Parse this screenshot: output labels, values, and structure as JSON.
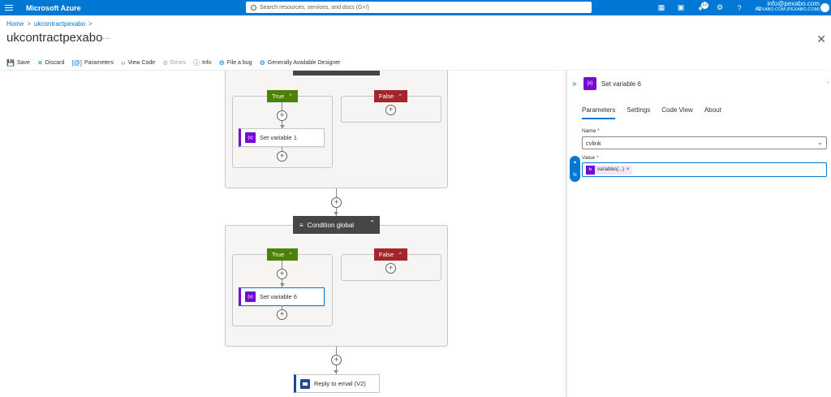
{
  "topbar": {
    "brand": "Microsoft Azure",
    "search_placeholder": "Search resources, services, and docs (G+/)",
    "notification_count": "12",
    "account_email": "info@pexabo.com",
    "account_directory": "PEXABO.COM (PEXABO.COM)"
  },
  "breadcrumb": {
    "home": "Home",
    "sep": ">",
    "resource": "ukcontractpexabo"
  },
  "page": {
    "title": "ukcontractpexabo",
    "more": "···"
  },
  "toolbar": {
    "save": "Save",
    "discard": "Discard",
    "parameters": "Parameters",
    "view_code": "View Code",
    "errors": "Errors",
    "info": "Info",
    "file_bug": "File a bug",
    "ga_designer": "Generally Available Designer"
  },
  "canvas": {
    "true_label": "True",
    "false_label": "False",
    "plus": "+",
    "set_variable_1": "Set variable 1",
    "condition_global": "Condition global",
    "set_variable_6": "Set variable 6",
    "reply_email": "Reply to email (V2)",
    "var_icon": "{x}"
  },
  "panel": {
    "title": "Set variable 6",
    "icon": "{x}",
    "tabs": [
      "Parameters",
      "Settings",
      "Code View",
      "About"
    ],
    "name_label": "Name",
    "name_value": "cvlink",
    "value_label": "Value",
    "token_text": "variables(...)",
    "token_icon": "fx",
    "required_mark": "*"
  },
  "colors": {
    "azure_blue": "#0078d4",
    "true_green": "#498205",
    "false_red": "#a4262c",
    "variable_purple": "#770bd6"
  }
}
